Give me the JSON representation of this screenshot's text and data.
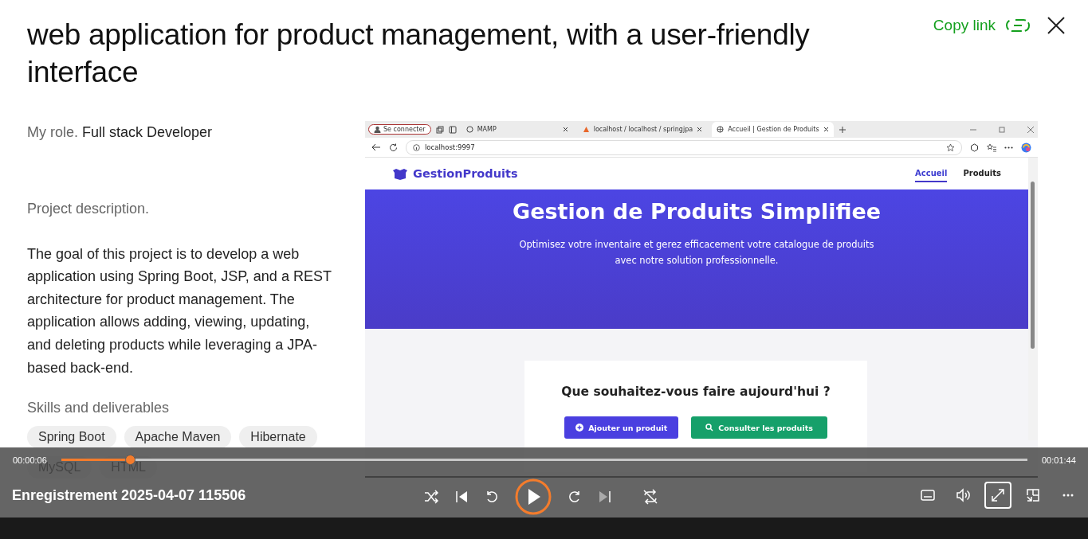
{
  "header": {
    "title": "web application for product management, with a user-friendly interface",
    "copy_link": "Copy link"
  },
  "role": {
    "label": "My role.",
    "value": "Full stack Developer"
  },
  "description": {
    "heading": "Project description.",
    "text": "The goal of this project is to develop a web application using Spring Boot, JSP, and a REST architecture for product management. The application allows adding, viewing, updating, and deleting products while leveraging a JPA-based back-end."
  },
  "skills": {
    "heading": "Skills and deliverables",
    "tags": [
      "Spring Boot",
      "Apache Maven",
      "Hibernate",
      "MySQL",
      "HTML"
    ]
  },
  "recording": {
    "browser": {
      "profile_button": "Se connecter",
      "address": "localhost:9997",
      "tabs": [
        {
          "label": "MAMP",
          "selected": false
        },
        {
          "label": "localhost / localhost / springjpa",
          "selected": false
        },
        {
          "label": "Accueil | Gestion de Produits",
          "selected": true
        }
      ]
    },
    "app": {
      "brand": "GestionProduits",
      "nav": [
        {
          "label": "Accueil",
          "selected": true
        },
        {
          "label": "Produits",
          "selected": false
        }
      ],
      "hero_title": "Gestion de Produits Simplifiee",
      "hero_subtitle": "Optimisez votre inventaire et gerez efficacement votre catalogue de produits avec notre solution professionnelle.",
      "prompt": "Que souhaitez-vous faire aujourd'hui ?",
      "actions": [
        {
          "label": "Ajouter un produit",
          "kind": "add"
        },
        {
          "label": "Consulter les produits",
          "kind": "search"
        }
      ]
    }
  },
  "player": {
    "elapsed": "00:00:06",
    "duration": "00:01:44",
    "level": 0.066,
    "title": "Enregistrement 2025-04-07 115506",
    "fullscreen_focused": true
  }
}
